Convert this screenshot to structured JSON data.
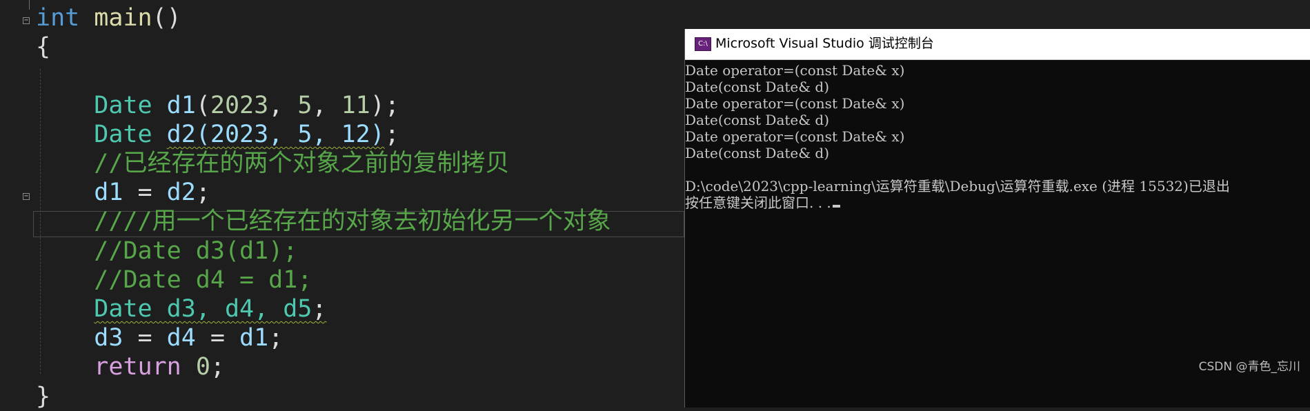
{
  "editor": {
    "lines": [
      {
        "id": "main-signature",
        "tokens": [
          {
            "c": "kw",
            "t": "int"
          },
          {
            "c": "pun",
            "t": " "
          },
          {
            "c": "fn",
            "t": "main"
          },
          {
            "c": "pun",
            "t": "()"
          }
        ]
      },
      {
        "id": "open-brace",
        "tokens": [
          {
            "c": "pun",
            "t": "{"
          }
        ]
      },
      {
        "id": "blank",
        "tokens": []
      },
      {
        "id": "d1-decl",
        "tokens": [
          {
            "c": "pun",
            "t": "    "
          },
          {
            "c": "type",
            "t": "Date"
          },
          {
            "c": "pun",
            "t": " "
          },
          {
            "c": "var",
            "t": "d1"
          },
          {
            "c": "pun",
            "t": "("
          },
          {
            "c": "num",
            "t": "2023"
          },
          {
            "c": "pun",
            "t": ", "
          },
          {
            "c": "num",
            "t": "5"
          },
          {
            "c": "pun",
            "t": ", "
          },
          {
            "c": "num",
            "t": "11"
          },
          {
            "c": "pun",
            "t": ");"
          }
        ]
      },
      {
        "id": "d2-decl",
        "tokens": [
          {
            "c": "pun",
            "t": "    "
          },
          {
            "c": "type",
            "t": "Date"
          },
          {
            "c": "pun",
            "t": " "
          },
          {
            "c": "var squig",
            "t": "d2(2023, 5, 12)"
          },
          {
            "c": "pun",
            "t": ";"
          }
        ]
      },
      {
        "id": "comment-copy-assign",
        "tokens": [
          {
            "c": "pun",
            "t": "    "
          },
          {
            "c": "com",
            "t": "//已经存在的两个对象之前的复制拷贝"
          }
        ]
      },
      {
        "id": "assign-d1",
        "tokens": [
          {
            "c": "pun",
            "t": "    "
          },
          {
            "c": "var",
            "t": "d1"
          },
          {
            "c": "pun",
            "t": " = "
          },
          {
            "c": "var",
            "t": "d2"
          },
          {
            "c": "pun",
            "t": ";"
          }
        ]
      },
      {
        "id": "comment-copy-init",
        "tokens": [
          {
            "c": "pun",
            "t": "    "
          },
          {
            "c": "com",
            "t": "////用一个已经存在的对象去初始化另一个对象"
          }
        ]
      },
      {
        "id": "comment-d3",
        "tokens": [
          {
            "c": "pun",
            "t": "    "
          },
          {
            "c": "com",
            "t": "//Date d3(d1);"
          }
        ]
      },
      {
        "id": "comment-d4",
        "tokens": [
          {
            "c": "pun",
            "t": "    "
          },
          {
            "c": "com",
            "t": "//Date d4 = d1;"
          }
        ]
      },
      {
        "id": "d3-d4-d5-decl",
        "tokens": [
          {
            "c": "pun",
            "t": "    "
          },
          {
            "c": "type squig",
            "t": "Date d3, d4, d5"
          },
          {
            "c": "pun squig",
            "t": ";"
          }
        ]
      },
      {
        "id": "chain-assign",
        "tokens": [
          {
            "c": "pun",
            "t": "    "
          },
          {
            "c": "var",
            "t": "d3"
          },
          {
            "c": "pun",
            "t": " = "
          },
          {
            "c": "var",
            "t": "d4"
          },
          {
            "c": "pun",
            "t": " = "
          },
          {
            "c": "var",
            "t": "d1"
          },
          {
            "c": "pun",
            "t": ";"
          }
        ]
      },
      {
        "id": "return",
        "tokens": [
          {
            "c": "pun",
            "t": "    "
          },
          {
            "c": "kw-ctrl",
            "t": "return"
          },
          {
            "c": "pun",
            "t": " "
          },
          {
            "c": "num",
            "t": "0"
          },
          {
            "c": "pun",
            "t": ";"
          }
        ]
      },
      {
        "id": "close-brace",
        "tokens": [
          {
            "c": "pun",
            "t": "}"
          }
        ]
      }
    ]
  },
  "console": {
    "icon_text": "C:\\",
    "title": "Microsoft Visual Studio 调试控制台",
    "output": [
      "Date operator=(const Date& x)",
      "Date(const Date& d)",
      "Date operator=(const Date& x)",
      "Date(const Date& d)",
      "Date operator=(const Date& x)",
      "Date(const Date& d)",
      "",
      "D:\\code\\2023\\cpp-learning\\运算符重载\\Debug\\运算符重载.exe (进程 15532)已退出",
      "按任意键关闭此窗口. . ."
    ]
  },
  "watermark": "CSDN @青色_忘川",
  "colors": {
    "editor_bg": "#1e1e1e",
    "keyword": "#569cd6",
    "type": "#4ec9b0",
    "function": "#dcdcaa",
    "variable": "#9cdcfe",
    "number": "#b5cea8",
    "comment": "#57a64a",
    "control": "#d8a0df",
    "console_bg": "#0c0c0c",
    "console_text": "#c8c8c8"
  }
}
